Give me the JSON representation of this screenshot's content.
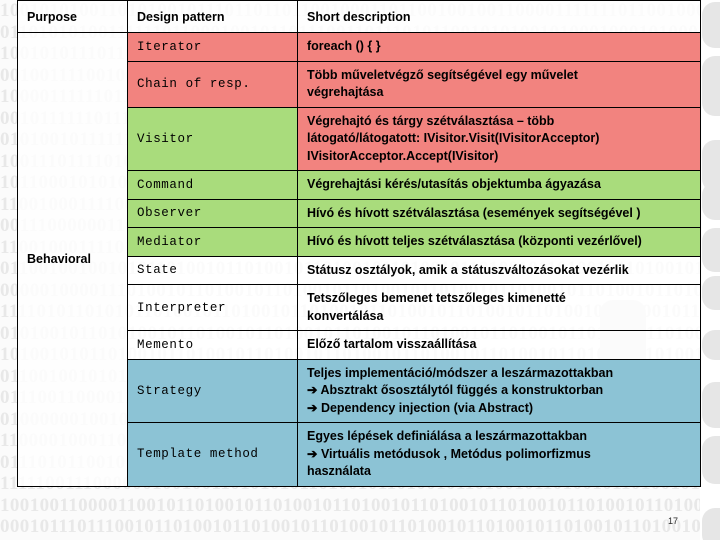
{
  "slide": {
    "page_number": "17",
    "background_text_rows": [
      "1001010100110101001011101101101100100011011001001001100001111111011001000100",
      "0110101010011111101100010010110111001101110101100101010010100010001010001001",
      "1001010111011010101110110110010011010011001110110110110101100000010101010100",
      "0010011110010010010011010101001101000101110110101101110101011000000101010010",
      "1000011111101101001011010010011010101000100101101001101010010110000101011001",
      "0010111111011101001011101101011010110010100110101101011010110100101010011011",
      "0101001011111100101001001101010110010100101101101001010010110101101011010101",
      "1001110111101001010110010011010011011010010100101100100010110100011101010011",
      "1011000101010011010010110100101101011010010010110101001011010110100101101001",
      "1100100011110010100101101001011010010110100101101001011010010110100101101001",
      "0011100000011010101011010010110100101101001011010010110100101101001011010010",
      "1100100011110110101001011010010110100101101001011010010110100101101001011010",
      "0110010010010101101001011010010110100101101001011010010110100101101001011010",
      "0000010000111010010110100101101001011010010110100101101001011010010110100101",
      "1111010110101011010010110100101101001011010010110100101101001011010010110100",
      "0101001011010100101101001011010010110100101101001011010010110100101101001011",
      "1010010101101001011010010110100101101001011010010110100101101001011010010110",
      "0110010010101011100100010110100101101001011010010110100101101001011010010110",
      "0111001100001101100101110010101111111101111101010101101011100001011101011010",
      "0100000010010101010110010110100101101001011010010110100101101001011010010110",
      "1100001000110000000110000010011010010110100101101001011010010110100101101001",
      "0111010110010110100101101001011010010110100101101001011010010110100101101001",
      "1111100111000000100100110101010110100101101001011010010110100101101001011010",
      "1001001100001100101101001011010010110100101101001011010010110100101101001011",
      "0001011101110010110100101101001011010010110100101101001011010010110100101101",
      "1011101101011100100010000001100001001011010010110100101101001011010010110100"
    ]
  },
  "table": {
    "headers": [
      "Purpose",
      "Design pattern",
      "Short description"
    ],
    "purpose_label": "Behavioral",
    "rows": [
      {
        "pattern": "Iterator",
        "fill": "fill-red",
        "desc_fill": "fill-red",
        "desc_lines": [
          "foreach () { }"
        ]
      },
      {
        "pattern": "Chain of resp.",
        "fill": "fill-red",
        "desc_fill": "fill-red",
        "desc_lines": [
          "Több műveletvégző segítségével  egy művelet",
          "végrehajtása"
        ]
      },
      {
        "pattern": "Visitor",
        "fill": "fill-green",
        "desc_fill": "fill-red",
        "desc_lines": [
          "Végrehajtó és tárgy szétválasztása – több",
          "látogató/látogatott: IVisitor.Visit(IVisitorAcceptor)",
          "IVisitorAcceptor.Accept(IVisitor)"
        ]
      },
      {
        "pattern": "Command",
        "fill": "fill-green",
        "desc_fill": "fill-green",
        "desc_lines": [
          "Végrehajtási kérés/utasítás objektumba ágyazása"
        ]
      },
      {
        "pattern": "Observer",
        "fill": "fill-green",
        "desc_fill": "fill-green",
        "desc_lines": [
          "Hívó és hívott szétválasztása  (események segítségével )"
        ]
      },
      {
        "pattern": "Mediator",
        "fill": "fill-green",
        "desc_fill": "fill-green",
        "desc_lines": [
          "Hívó és hívott teljes szétválasztása (központi vezérlővel)"
        ]
      },
      {
        "pattern": "State",
        "fill": "fill-none",
        "desc_fill": "fill-none",
        "desc_lines": [
          "Státusz osztályok, amik a  státuszváltozásokat vezérlik"
        ]
      },
      {
        "pattern": "Interpreter",
        "fill": "fill-none",
        "desc_fill": "fill-none",
        "desc_lines": [
          "Tetszőleges bemenet  tetszőleges kimenetté",
          "konvertálása"
        ]
      },
      {
        "pattern": "Memento",
        "fill": "fill-none",
        "desc_fill": "fill-none",
        "desc_lines": [
          "Előző tartalom visszaállítása"
        ]
      },
      {
        "pattern": "Strategy",
        "fill": "fill-blue",
        "desc_fill": "fill-blue",
        "desc_lines": [
          "Teljes implementáció/módszer  a leszármazottakban",
          "➔ Absztrakt ősosztálytól függés a konstruktorban",
          "➔ Dependency injection  (via Abstract)"
        ]
      },
      {
        "pattern": "Template method",
        "fill": "fill-blue",
        "desc_fill": "fill-blue",
        "desc_lines": [
          "Egyes lépések definiálása a leszármazottakban",
          "➔ Virtuális metódusok , Metódus polimorfizmus",
          "használata"
        ]
      }
    ]
  },
  "colors": {
    "red": "#F2837F",
    "green": "#A9DC7C",
    "blue": "#8CC3D5",
    "border": "#000000",
    "background_digits": "#e8e8e8"
  }
}
